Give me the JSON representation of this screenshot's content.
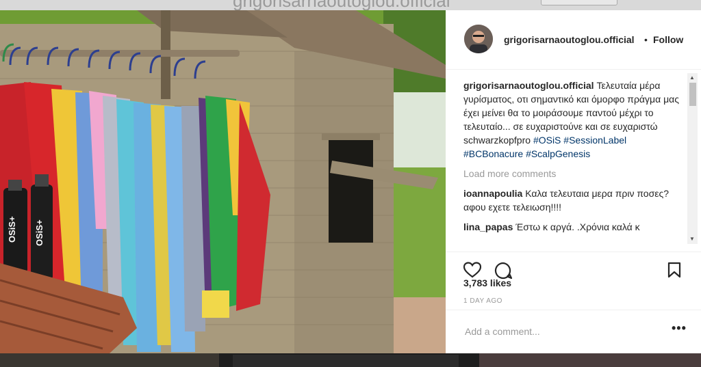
{
  "topbar": {
    "ghost_text": "grigorisarnaoutoglou.official"
  },
  "post": {
    "username": "grigorisarnaoutoglou.official",
    "dot": "•",
    "follow_label": "Follow",
    "caption": {
      "author": "grigorisarnaoutoglou.official",
      "text": "Τελευταία μέρα γυρίσματος, οτι σημαντικό και όμορφο πράγμα μας έχει μείνει θα το μοιράσουμε παντού μέχρι το τελευταίο... σε ευχαριστούνε και σε ευχαριστώ schwarzkopfpro",
      "tags": [
        "#OSiS",
        "#SessionLabel",
        "#BCBonacure",
        "#ScalpGenesis"
      ]
    },
    "load_more_label": "Load more comments",
    "comments": [
      {
        "user": "ioannapoulia",
        "text": "Καλα τελευταια μερα πριν ποσες?αφου εχετε τελειωση!!!!"
      },
      {
        "user": "lina_papas",
        "text": "Έστω κ αργά. .Χρόνια καλά κ"
      }
    ],
    "likes": "3,783 likes",
    "time": "1 DAY AGO",
    "add_comment_placeholder": "Add a comment...",
    "more_label": "•••",
    "icons": {
      "like": "heart-icon",
      "comment": "comment-icon",
      "save": "bookmark-icon",
      "more": "more-icon"
    }
  },
  "photo": {
    "bottle_label": "OSiS+",
    "colors": {
      "accent_link": "#003569",
      "muted": "#999999",
      "text": "#262626"
    }
  }
}
